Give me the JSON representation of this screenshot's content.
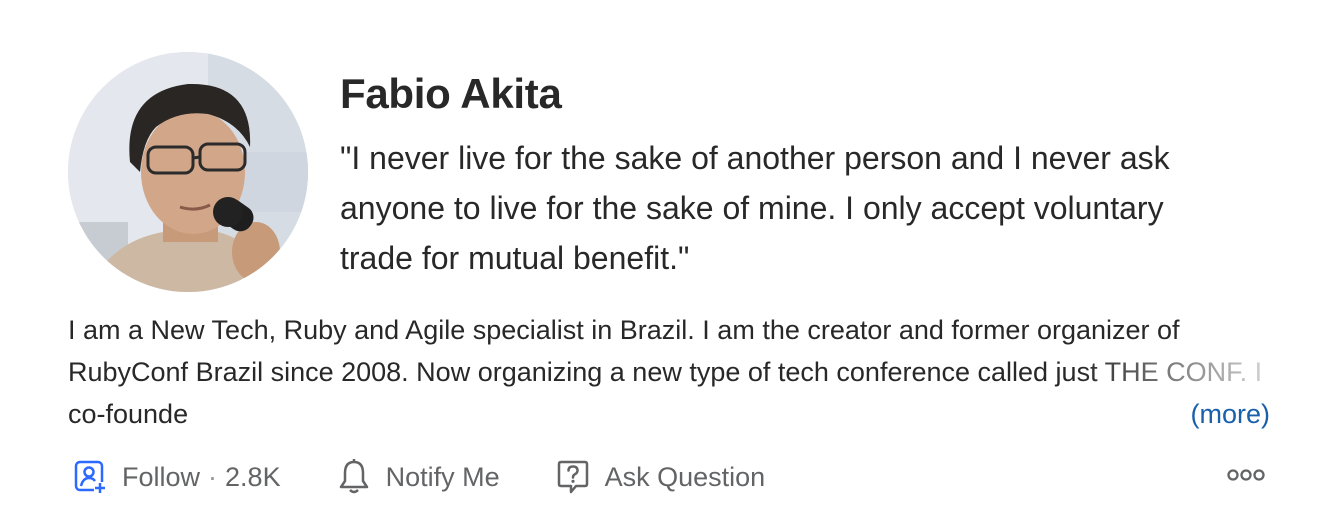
{
  "profile": {
    "name": "Fabio Akita",
    "tagline": "\"I never live for the sake of another person and I never ask anyone to live for the sake of mine. I only accept voluntary trade for mutual benefit.\"",
    "bio": "I am a New Tech, Ruby and Agile specialist in Brazil. I am the creator and former organizer of RubyConf Brazil since 2008. Now organizing a new type of tech conference called just THE CONF. I co-founde",
    "more_label": "(more)"
  },
  "actions": {
    "follow_label": "Follow",
    "separator": "·",
    "follower_count": "2.8K",
    "notify_label": "Notify Me",
    "ask_label": "Ask Question"
  },
  "icons": {
    "avatar": "profile-photo",
    "follow": "follow-user-icon",
    "notify": "bell-icon",
    "ask": "question-bubble-icon",
    "overflow": "more-options-icon"
  },
  "colors": {
    "text": "#282829",
    "secondary": "#636466",
    "accent": "#2e69ff",
    "link": "#195faa"
  }
}
